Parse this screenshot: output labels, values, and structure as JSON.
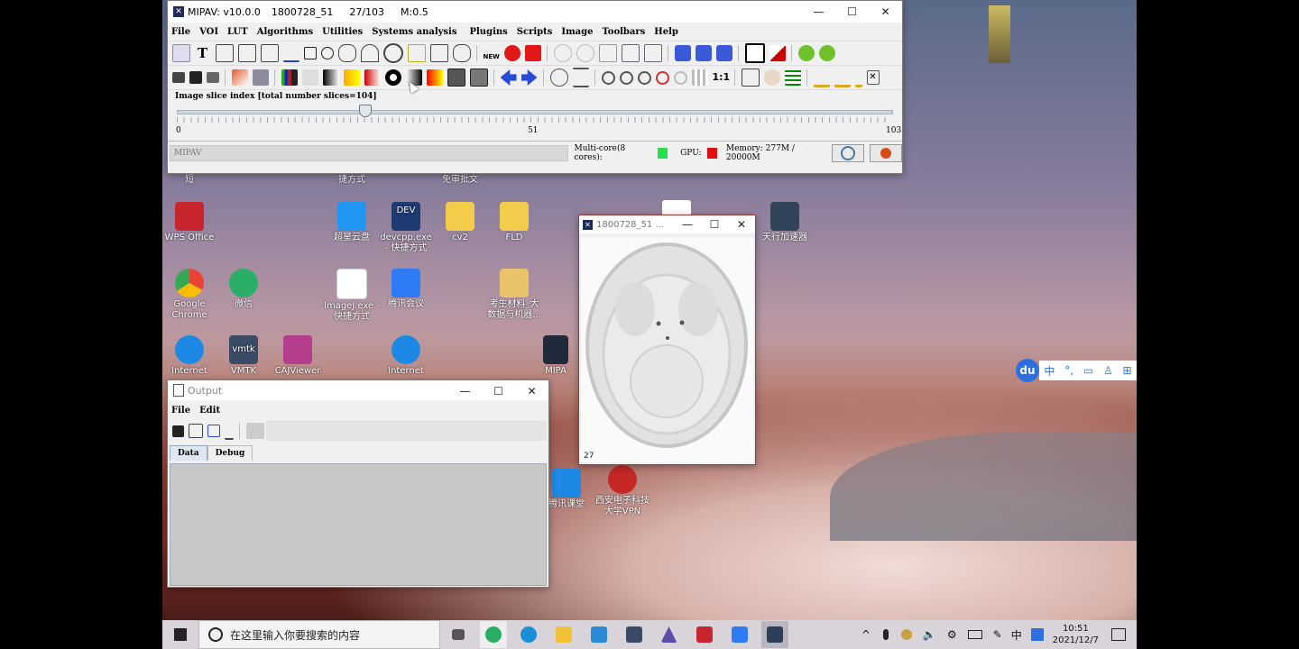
{
  "desktop": {
    "icons": [
      {
        "label": "WPS Office",
        "color": "#c8262f"
      },
      {
        "label": "Google Chrome",
        "color": "#4285f4"
      },
      {
        "label": "微信",
        "color": "#2aae67"
      },
      {
        "label": "Internet",
        "color": "#1e88e5"
      },
      {
        "label": "VMTK",
        "color": "#3b4b66"
      },
      {
        "label": "CAJViewer",
        "color": "#b63e8e"
      },
      {
        "label": "Internet",
        "color": "#1e88e5"
      },
      {
        "label": "超星云盘",
        "color": "#2196f3"
      },
      {
        "label": "devcpp.exe - 快捷方式",
        "color": "#1f3b73"
      },
      {
        "label": "cv2",
        "color": "#f4cc4b"
      },
      {
        "label": "FLD",
        "color": "#f4cc4b"
      },
      {
        "label": "ImageJ.exe - 快捷方式",
        "color": "#ffffff"
      },
      {
        "label": "腾讯会议",
        "color": "#2d7cf6"
      },
      {
        "label": "考生材料_大数据与机器...",
        "color": "#e8c36a"
      },
      {
        "label": "天行加速器",
        "color": "#33445a"
      },
      {
        "label": "MIPA",
        "color": "#202a3b"
      },
      {
        "label": "腾讯课堂",
        "color": "#1e88e5"
      },
      {
        "label": "西安电子科技大学VPN",
        "color": "#c62828"
      }
    ],
    "partial_labels": [
      "短",
      "捷方式",
      "免审批文"
    ]
  },
  "mipav": {
    "title": "MIPAV:  v10.0.0",
    "image_name": "1800728_51",
    "slice_info": "27/103",
    "zoom": "M:0.5",
    "window_controls": {
      "minimize": "—",
      "maximize": "☐",
      "close": "✕"
    },
    "menu": [
      "File",
      "VOI",
      "LUT",
      "Algorithms",
      "Utilities",
      "Systems analysis",
      "Plugins",
      "Scripts",
      "Image",
      "Toolbars",
      "Help"
    ],
    "slider": {
      "label": "Image slice index  [total number slices=104]",
      "min": "0",
      "mid": "51",
      "max": "103",
      "value": 27,
      "min_value": 0,
      "max_value": 103
    },
    "status": {
      "text": "MIPAV",
      "multicore_label": "Multi-core(8 cores):",
      "multicore_color": "#22e050",
      "gpu_label": "GPU:",
      "gpu_color": "#e01010",
      "memory": "Memory: 277M / 20000M"
    }
  },
  "image_window": {
    "title": "1800728_51 ...",
    "slice_number": "27"
  },
  "output_window": {
    "title": "Output",
    "menu": [
      "File",
      "Edit"
    ],
    "tabs": [
      "Data",
      "Debug"
    ],
    "active_tab": "Data"
  },
  "baidu_toolbar": {
    "logo": "du",
    "items": [
      "中",
      "°,",
      "▭",
      "♙",
      "⊞"
    ]
  },
  "taskbar": {
    "search_placeholder": "在这里输入你要搜索的内容",
    "time": "10:51",
    "date": "2021/12/7",
    "ime": "中",
    "apps": [
      {
        "name": "task-view",
        "color": "#333"
      },
      {
        "name": "wechat",
        "color": "#2aae67"
      },
      {
        "name": "edge",
        "color": "#1c8fd8"
      },
      {
        "name": "file-explorer",
        "color": "#f2c13a"
      },
      {
        "name": "photos",
        "color": "#2b8ad6"
      },
      {
        "name": "vmtk",
        "color": "#3b4b66"
      },
      {
        "name": "paint-app",
        "color": "#5b4ea8"
      },
      {
        "name": "wps",
        "color": "#c8262f"
      },
      {
        "name": "tencent-meeting",
        "color": "#2d7cf6"
      },
      {
        "name": "mipav",
        "color": "#2f3e58"
      }
    ]
  }
}
